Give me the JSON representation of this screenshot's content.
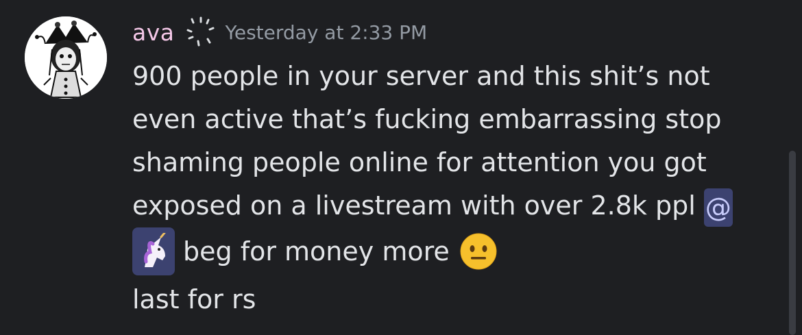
{
  "message": {
    "author": {
      "name": "ava",
      "name_color": "#f4c7e7",
      "avatar_icon": "jester-doll-avatar",
      "badge_icon": "sparkle-badge-icon"
    },
    "timestamp": "Yesterday at 2:33 PM",
    "lines": [
      "900 people in your server and this shit’s not",
      "even active that’s fucking embarrassing stop",
      "shaming people online for attention you got",
      "exposed on a livestream with over 2.8k ppl"
    ],
    "mention_at": "@",
    "mention_emoji_icon": "unicorn-emoji-icon",
    "line5_text": "beg for money more",
    "line5_emoji_icon": "neutral-face-emoji-icon",
    "last_line": "last for rs"
  },
  "colors": {
    "background": "#1e1f22",
    "text": "#e3e5e8",
    "timestamp": "#949ba4",
    "mention_bg": "#3c4270",
    "mention_fg": "#c9cdfb"
  }
}
